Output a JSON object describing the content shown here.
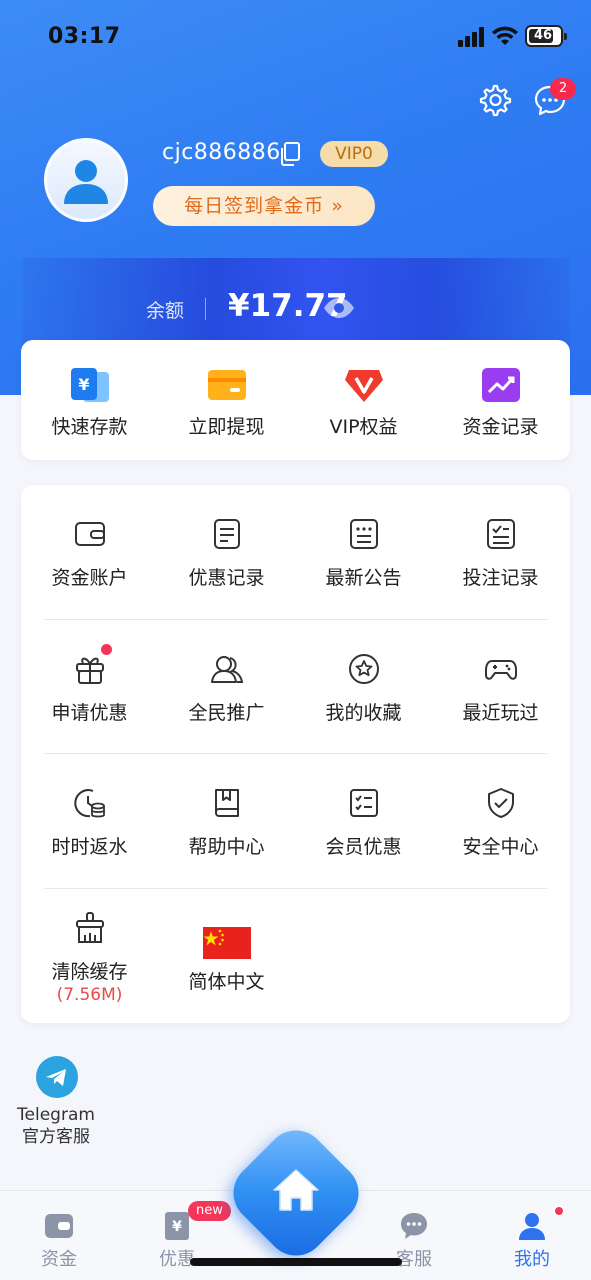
{
  "status_bar": {
    "time": "03:17",
    "battery": "46"
  },
  "header": {
    "message_count": "2"
  },
  "profile": {
    "username": "cjc886886",
    "vip_level": "VIP0",
    "signin_label": "每日签到拿金币 »"
  },
  "balance": {
    "label": "余额",
    "value": "¥17.77"
  },
  "quick_actions": [
    {
      "label": "快速存款",
      "icon": "deposit-icon"
    },
    {
      "label": "立即提现",
      "icon": "withdraw-icon"
    },
    {
      "label": "VIP权益",
      "icon": "vip-icon"
    },
    {
      "label": "资金记录",
      "icon": "chart-icon"
    }
  ],
  "menu": {
    "items": [
      {
        "label": "资金账户",
        "icon": "wallet-icon"
      },
      {
        "label": "优惠记录",
        "icon": "document-icon"
      },
      {
        "label": "最新公告",
        "icon": "notice-icon"
      },
      {
        "label": "投注记录",
        "icon": "checklist-icon"
      },
      {
        "label": "申请优惠",
        "icon": "gift-icon"
      },
      {
        "label": "全民推广",
        "icon": "users-icon"
      },
      {
        "label": "我的收藏",
        "icon": "star-icon"
      },
      {
        "label": "最近玩过",
        "icon": "gamepad-icon"
      },
      {
        "label": "时时返水",
        "icon": "rebate-icon"
      },
      {
        "label": "帮助中心",
        "icon": "book-icon"
      },
      {
        "label": "会员优惠",
        "icon": "list-check-icon"
      },
      {
        "label": "安全中心",
        "icon": "shield-icon"
      },
      {
        "label": "清除缓存",
        "sub": "(7.56M)",
        "icon": "broom-icon"
      },
      {
        "label": "简体中文",
        "icon": "flag-icon"
      }
    ]
  },
  "telegram": {
    "line1": "Telegram",
    "line2": "官方客服"
  },
  "bottom_nav": {
    "items": [
      {
        "label": "资金"
      },
      {
        "label": "优惠",
        "badge": "new"
      },
      {
        "label": "客服"
      },
      {
        "label": "我的"
      }
    ]
  },
  "colors": {
    "primary": "#2f7df2",
    "accent_red": "#f4365a",
    "vip_gold": "#f6dca8"
  }
}
